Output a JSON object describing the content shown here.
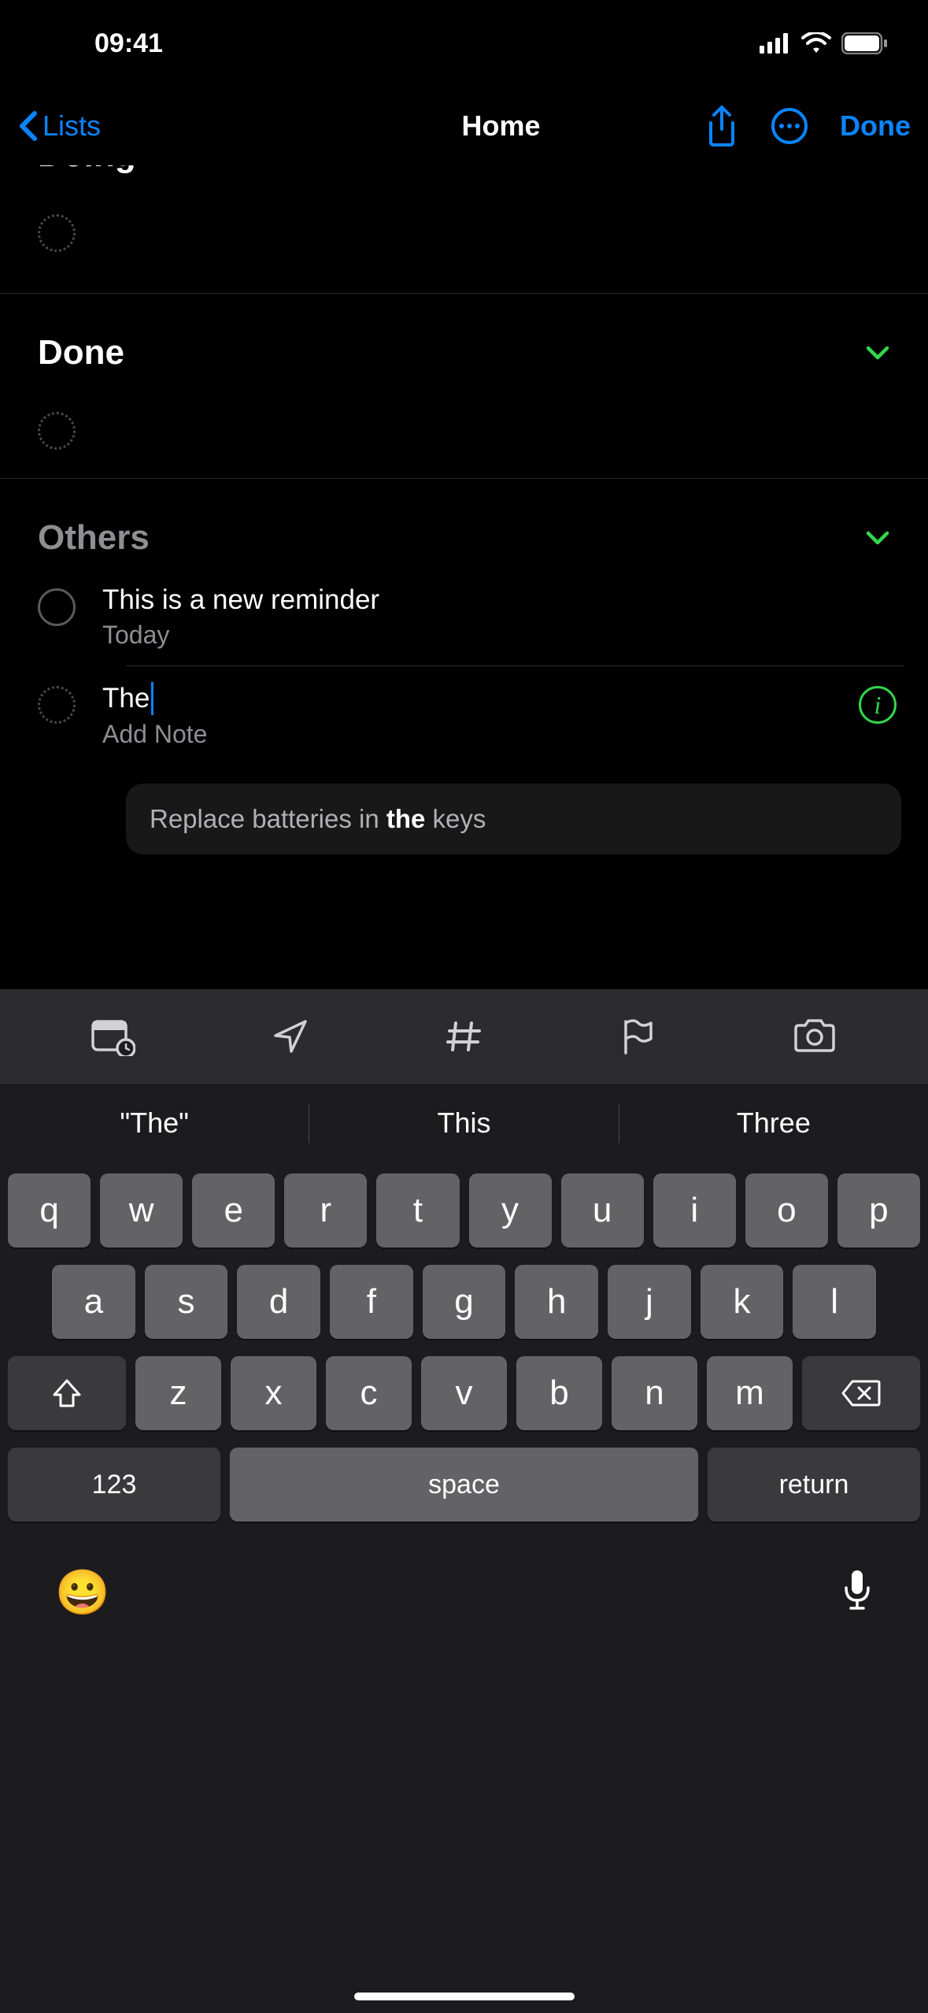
{
  "status": {
    "time": "09:41"
  },
  "nav": {
    "back_label": "Lists",
    "title": "Home",
    "done_label": "Done"
  },
  "sections": {
    "doing": {
      "title": "Doing"
    },
    "done": {
      "title": "Done"
    },
    "others": {
      "title": "Others"
    }
  },
  "reminders": {
    "r1": {
      "title": "This is a new reminder",
      "sub": "Today"
    },
    "editing": {
      "text": "The",
      "note_placeholder": "Add Note"
    }
  },
  "siri": {
    "prefix": "Replace batteries in ",
    "bold": "the",
    "suffix": " keys"
  },
  "suggestions": {
    "s1": "\"The\"",
    "s2": "This",
    "s3": "Three"
  },
  "keys": {
    "row1": [
      "q",
      "w",
      "e",
      "r",
      "t",
      "y",
      "u",
      "i",
      "o",
      "p"
    ],
    "row2": [
      "a",
      "s",
      "d",
      "f",
      "g",
      "h",
      "j",
      "k",
      "l"
    ],
    "row3": [
      "z",
      "x",
      "c",
      "v",
      "b",
      "n",
      "m"
    ],
    "k123": "123",
    "space": "space",
    "return": "return"
  }
}
